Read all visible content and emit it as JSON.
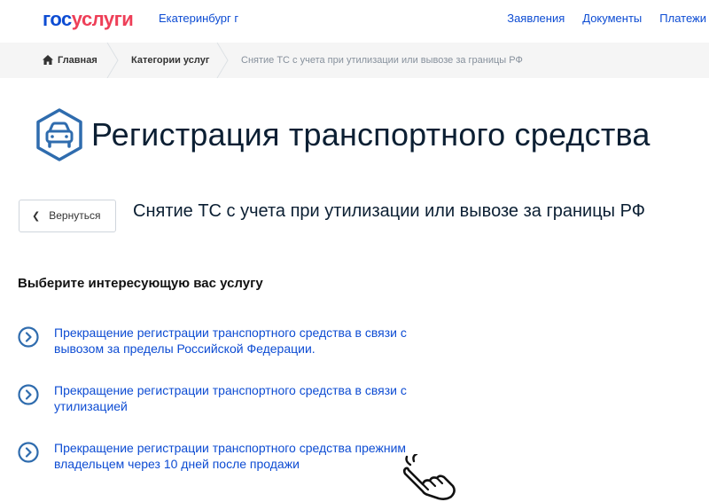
{
  "header": {
    "logo_part1": "гос",
    "logo_part2": "услуги",
    "city": "Екатеринбург г",
    "nav": [
      "Заявления",
      "Документы",
      "Платежи"
    ]
  },
  "breadcrumb": {
    "home": "Главная",
    "category": "Категории услуг",
    "current": "Снятие ТС с учета при утилизации или вывозе за границы РФ"
  },
  "page": {
    "title": "Регистрация транспортного средства",
    "back_label": "Вернуться",
    "subtitle": "Снятие ТС с учета при утилизации или вывозе за границы РФ",
    "section_heading": "Выберите интересующую вас услугу"
  },
  "services": [
    "Прекращение регистрации транспортного средства в связи с вывозом за пределы Российской Федерации.",
    "Прекращение регистрации транспортного средства в связи с утилизацией",
    "Прекращение регистрации транспортного средства прежним владельцем через 10 дней после продажи"
  ],
  "colors": {
    "link": "#0d4cd3",
    "brand_red": "#ee3f58",
    "icon_blue": "#2f6cae"
  }
}
